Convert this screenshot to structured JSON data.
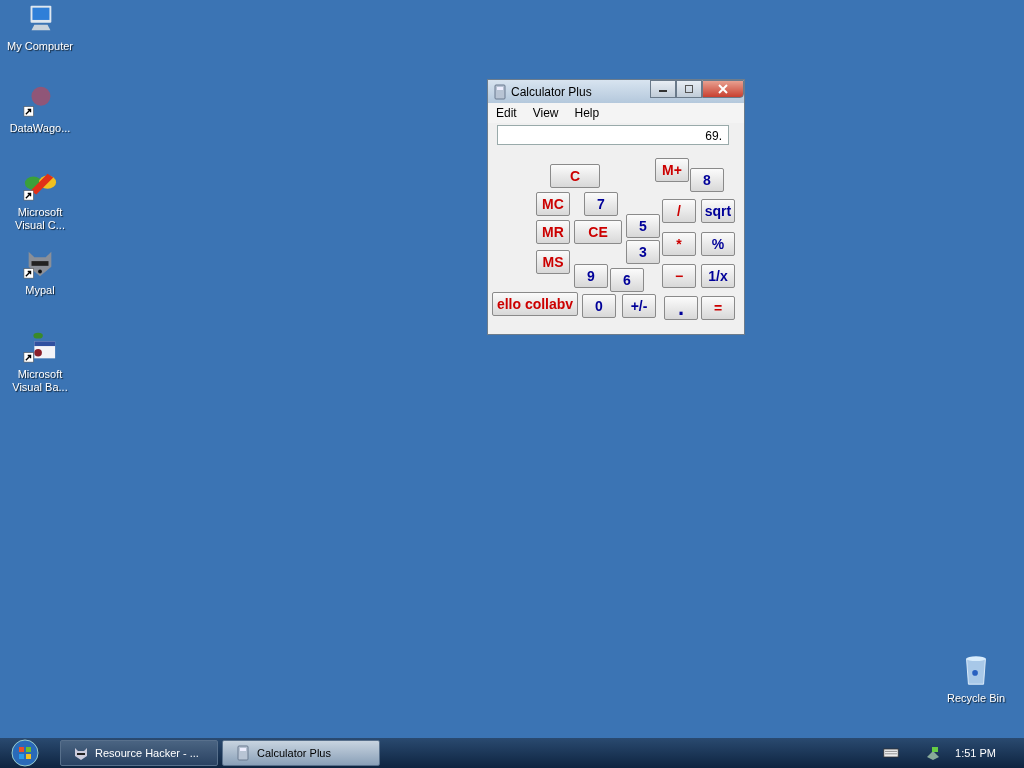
{
  "desktop_icons": [
    {
      "label": "My Computer",
      "kind": "computer",
      "shortcut": false
    },
    {
      "label": "DataWago...",
      "kind": "blur",
      "shortcut": true
    },
    {
      "label": "Microsoft Visual C...",
      "kind": "studio",
      "shortcut": true
    },
    {
      "label": "Mypal",
      "kind": "raccoon",
      "shortcut": true
    },
    {
      "label": "Microsoft Visual Ba...",
      "kind": "basic",
      "shortcut": true
    }
  ],
  "recycle_bin": {
    "label": "Recycle Bin"
  },
  "window": {
    "title": "Calculator Plus",
    "menu": [
      "Edit",
      "View",
      "Help"
    ],
    "display": "69.",
    "buttons": [
      {
        "label": "M+",
        "color": "#cc0000"
      },
      {
        "label": "8",
        "color": "#000099"
      },
      {
        "label": "C",
        "color": "#cc0000"
      },
      {
        "label": "MC",
        "color": "#cc0000"
      },
      {
        "label": "7",
        "color": "#000099"
      },
      {
        "label": "CE",
        "color": "#cc0000"
      },
      {
        "label": "5",
        "color": "#000099"
      },
      {
        "label": "/",
        "color": "#cc0000"
      },
      {
        "label": "sqrt",
        "color": "#000099"
      },
      {
        "label": "MR",
        "color": "#cc0000"
      },
      {
        "label": "*",
        "color": "#cc0000"
      },
      {
        "label": "%",
        "color": "#000099"
      },
      {
        "label": "3",
        "color": "#000099"
      },
      {
        "label": "MS",
        "color": "#cc0000"
      },
      {
        "label": "6",
        "color": "#000099"
      },
      {
        "label": "9",
        "color": "#000099"
      },
      {
        "label": "−",
        "color": "#cc0000"
      },
      {
        "label": "1/x",
        "color": "#000099"
      },
      {
        "label": "ello collabv",
        "color": "#cc0000"
      },
      {
        "label": "0",
        "color": "#000099"
      },
      {
        "label": "+/-",
        "color": "#000099"
      },
      {
        "label": ".",
        "color": "#000099"
      },
      {
        "label": "=",
        "color": "#cc0000"
      }
    ]
  },
  "taskbar": {
    "tasks": [
      {
        "label": "Resource Hacker - ...",
        "kind": "raccoon",
        "selected": false
      },
      {
        "label": "Calculator Plus",
        "kind": "calculator",
        "selected": true
      }
    ],
    "clock": "1:51 PM"
  }
}
